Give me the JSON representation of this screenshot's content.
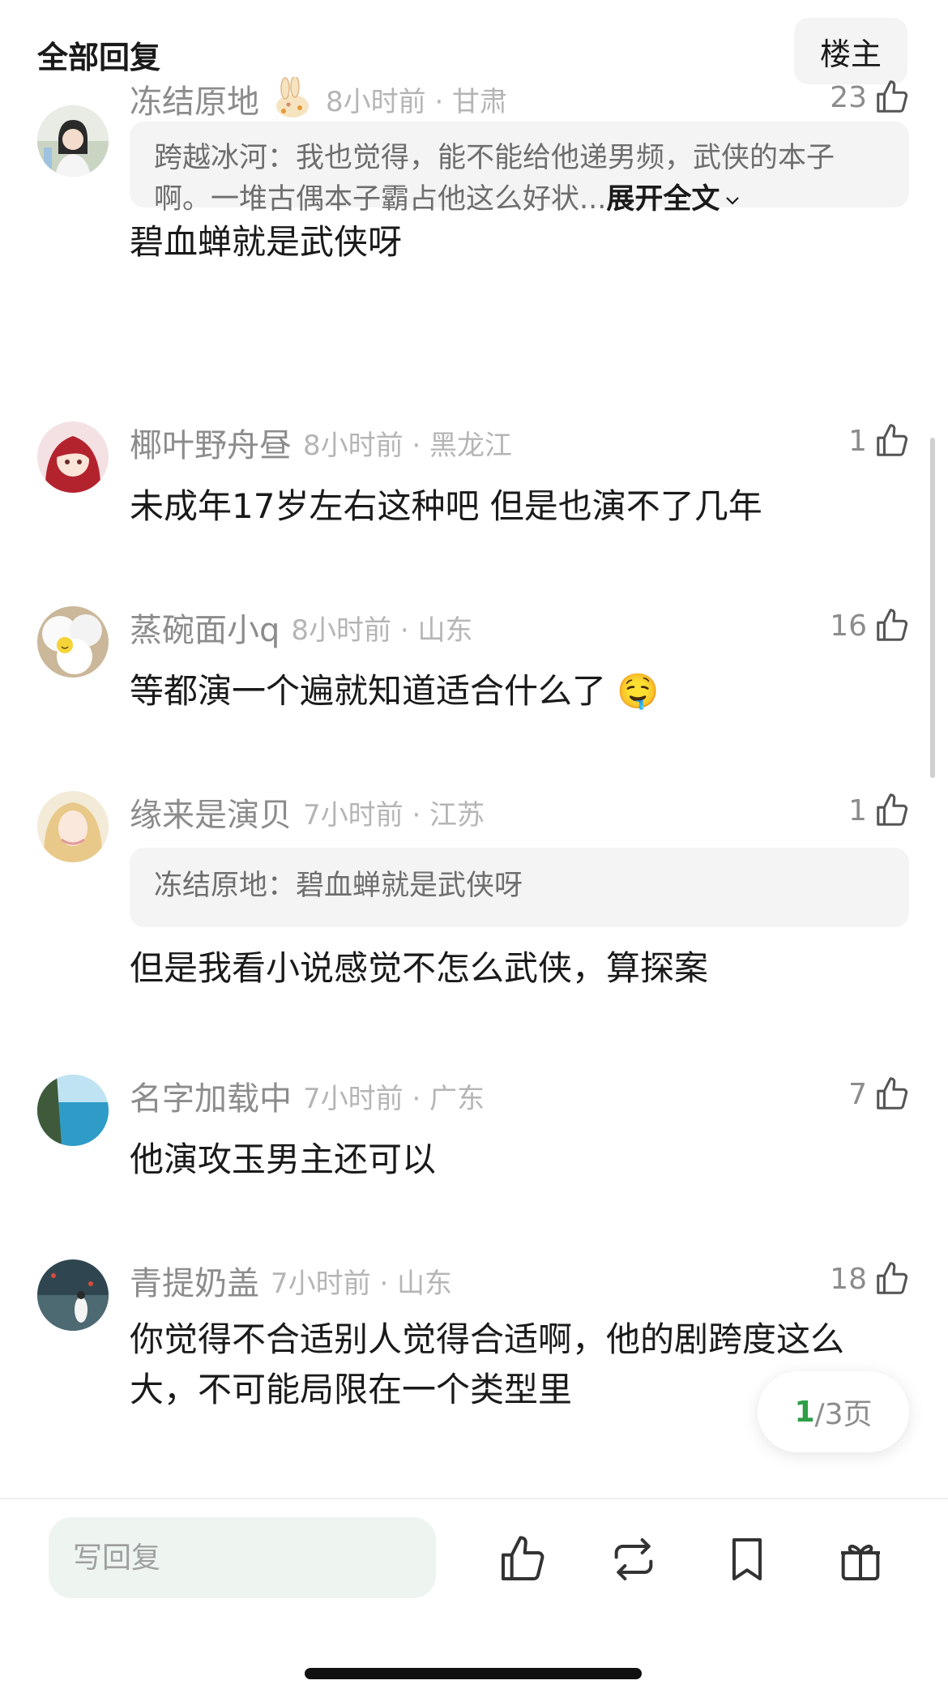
{
  "header": {
    "title": "全部回复",
    "owner_label": "楼主"
  },
  "comments": [
    {
      "username": "冻结原地",
      "time_location": "8小时前 · 甘肃",
      "likes": "23",
      "quote": {
        "text": "跨越冰河：我也觉得，能不能给他递男频，武侠的本子啊。一堆古偶本子霸占他这么好状...",
        "expand": "展开全文"
      },
      "text": "碧血蝉就是武侠呀"
    },
    {
      "username": "椰叶野舟昼",
      "time_location": "8小时前 · 黑龙江",
      "likes": "1",
      "text": "未成年17岁左右这种吧 但是也演不了几年"
    },
    {
      "username": "蒸碗面小q",
      "time_location": "8小时前 · 山东",
      "likes": "16",
      "text": "等都演一个遍就知道适合什么了",
      "emoji": "🤤"
    },
    {
      "username": "缘来是演贝",
      "time_location": "7小时前 · 江苏",
      "likes": "1",
      "quote": {
        "text": "冻结原地：碧血蝉就是武侠呀"
      },
      "text": "但是我看小说感觉不怎么武侠，算探案"
    },
    {
      "username": "名字加载中",
      "time_location": "7小时前 · 广东",
      "likes": "7",
      "text": "他演攻玉男主还可以"
    },
    {
      "username": "青提奶盖",
      "time_location": "7小时前 · 山东",
      "likes": "18",
      "text": "你觉得不合适别人觉得合适啊，他的剧跨度这么大，不可能局限在一个类型里"
    }
  ],
  "pager": {
    "current": "1",
    "total_text": "/3页"
  },
  "bottom_bar": {
    "reply_placeholder": "写回复"
  },
  "icons": {
    "like": "thumbs-up-icon",
    "repost": "repost-icon",
    "bookmark": "bookmark-icon",
    "gift": "gift-icon",
    "expand": "chevron-down-icon"
  },
  "colors": {
    "accent": "#2e9e46",
    "muted_text": "#8c8c8c",
    "quote_bg": "#f4f4f4",
    "input_bg": "#eef5f0"
  }
}
